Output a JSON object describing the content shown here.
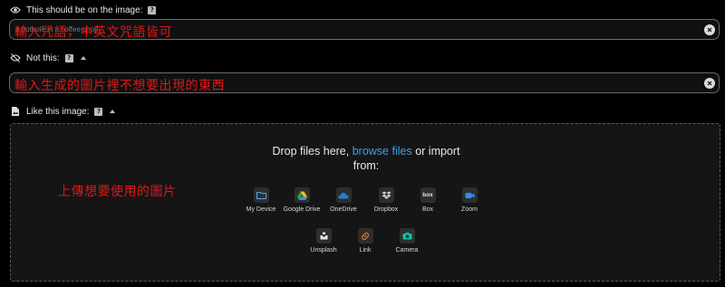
{
  "positive": {
    "label": "This should be on the image:",
    "help_badge": "?",
    "placeholder": "a pothole in a coffee shop",
    "overlay_note": "輸入咒語，中英文咒語皆可",
    "icon": "eye-icon"
  },
  "negative": {
    "label": "Not this:",
    "help_badge": "?",
    "overlay_note": "輸入生成的圖片裡不想要出現的東西",
    "icon": "eye-slash-icon"
  },
  "reference": {
    "label": "Like this image:",
    "help_badge": "?",
    "icon": "image-file-icon"
  },
  "dropzone": {
    "prefix": "Drop files here,",
    "link": "browse files",
    "suffix": "or import",
    "line2": "from:",
    "overlay_note": "上傳想要使用的圖片",
    "sources": [
      {
        "name": "My Device",
        "icon": "folder-icon",
        "color": "#4ea3f1"
      },
      {
        "name": "Google Drive",
        "icon": "google-drive-icon",
        "color": "#1fa463"
      },
      {
        "name": "OneDrive",
        "icon": "onedrive-icon",
        "color": "#1e7ed8"
      },
      {
        "name": "Dropbox",
        "icon": "dropbox-icon",
        "color": "#cfd6e0"
      },
      {
        "name": "Box",
        "icon": "box-icon",
        "color": "#e6e6e6"
      },
      {
        "name": "Zoom",
        "icon": "zoom-icon",
        "color": "#2d8cff"
      },
      {
        "name": "Unsplash",
        "icon": "unsplash-icon",
        "color": "#e6e6e6"
      },
      {
        "name": "Link",
        "icon": "link-icon",
        "color": "#e07a2e"
      },
      {
        "name": "Camera",
        "icon": "camera-icon",
        "color": "#13c2a3"
      }
    ]
  }
}
